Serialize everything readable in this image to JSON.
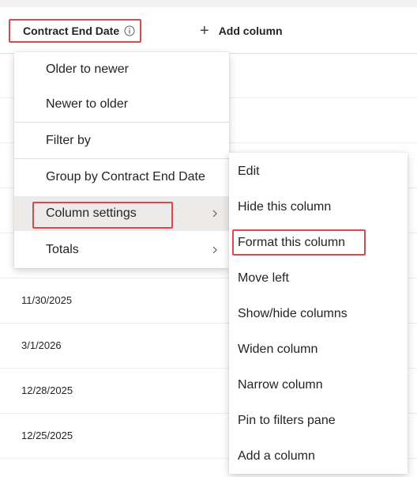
{
  "header": {
    "column_title": "Contract End Date",
    "add_column_label": "Add column",
    "add_icon": "plus-icon",
    "info_icon": "info-icon"
  },
  "rows": [
    {
      "date": ""
    },
    {
      "date": ""
    },
    {
      "date": ""
    },
    {
      "date": ""
    },
    {
      "date": ""
    },
    {
      "date": "11/30/2025"
    },
    {
      "date": "3/1/2026"
    },
    {
      "date": "12/28/2025"
    },
    {
      "date": "12/25/2025"
    }
  ],
  "context_menu": {
    "items": [
      {
        "label": "Older to newer"
      },
      {
        "label": "Newer to older"
      },
      {
        "label": "Filter by"
      },
      {
        "label": "Group by Contract End Date"
      },
      {
        "label": "Column settings",
        "submenu": true
      },
      {
        "label": "Totals",
        "submenu": true
      }
    ]
  },
  "submenu": {
    "items": [
      {
        "label": "Edit"
      },
      {
        "label": "Hide this column"
      },
      {
        "label": "Format this column"
      },
      {
        "label": "Move left"
      },
      {
        "label": "Show/hide columns"
      },
      {
        "label": "Widen column"
      },
      {
        "label": "Narrow column"
      },
      {
        "label": "Pin to filters pane"
      },
      {
        "label": "Add a column"
      }
    ]
  },
  "colors": {
    "highlight": "#e0464e",
    "active_item_bg": "#edebe9",
    "divider": "#e1dfdd"
  }
}
